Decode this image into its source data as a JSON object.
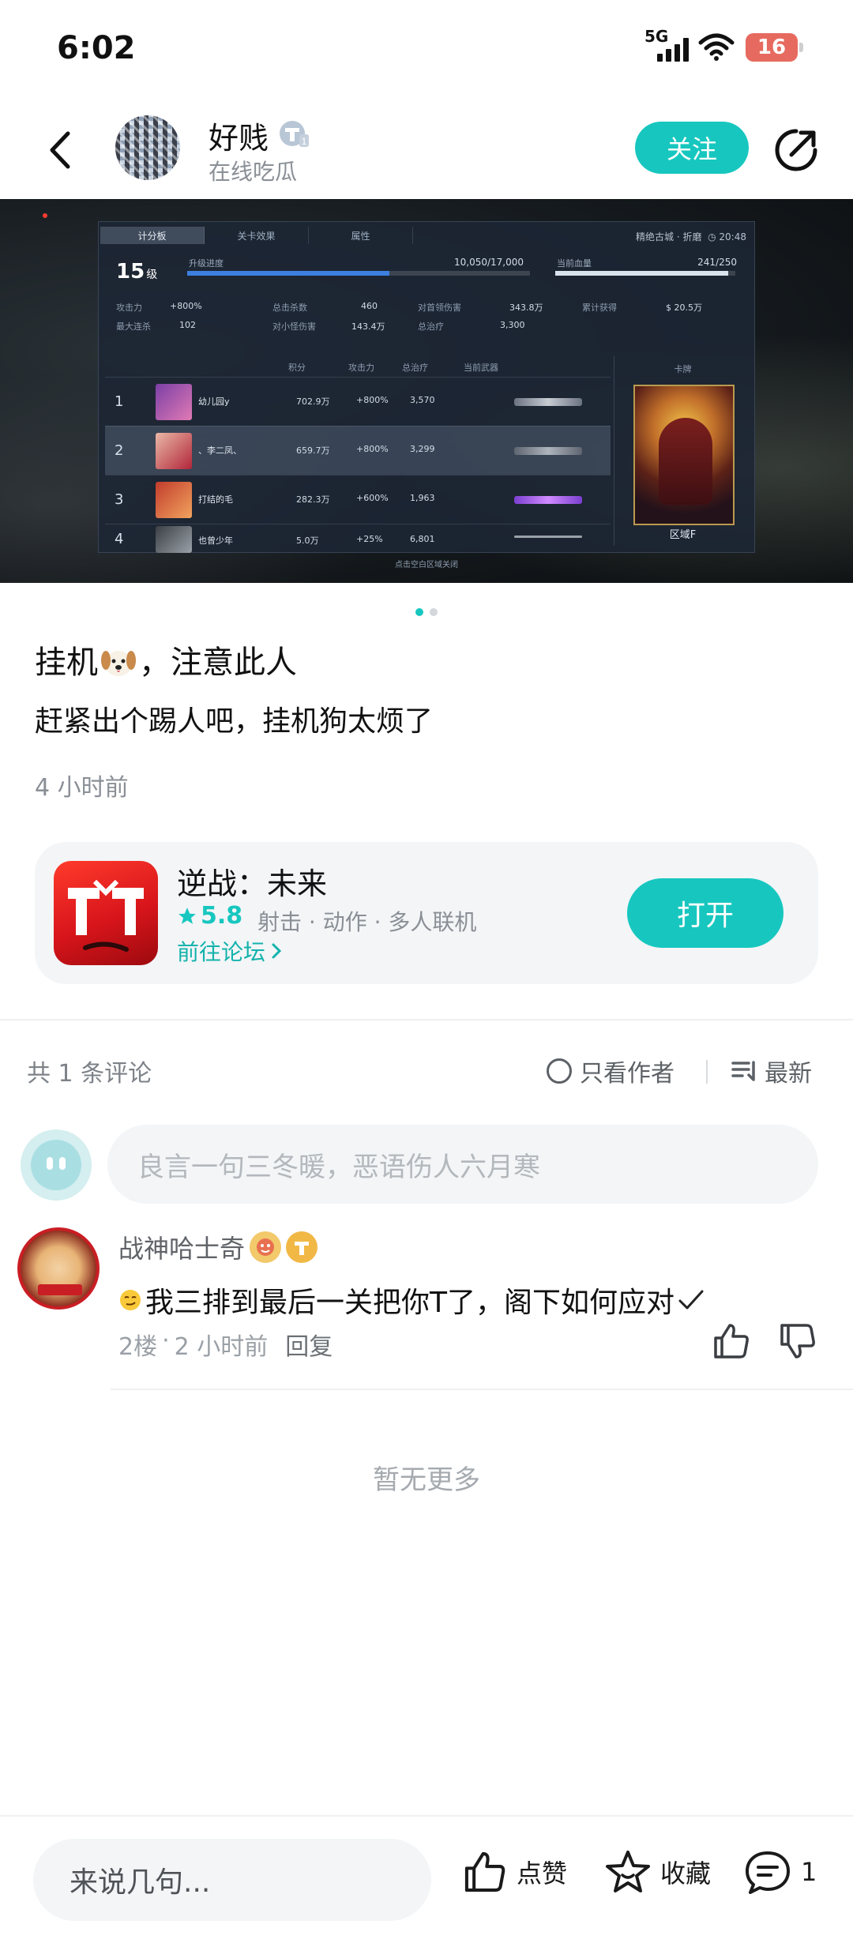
{
  "status_bar": {
    "time": "6:02",
    "network": "5G",
    "battery": "16",
    "icons": [
      "signal-icon",
      "wifi-icon",
      "battery-icon"
    ]
  },
  "header": {
    "username": "好贱",
    "subtitle": "在线吃瓜",
    "follow_label": "关注",
    "icons": [
      "back-icon",
      "verified-badge-icon",
      "share-icon"
    ]
  },
  "screenshot": {
    "tabs": [
      "计分板",
      "关卡效果",
      "属性"
    ],
    "location": "精绝古城 · 折磨",
    "timer": "20:48",
    "level": "15",
    "level_unit": "级",
    "progress_label": "升级进度",
    "progress_value": "10,050/17,000",
    "progress_fraction": 0.59,
    "hp_label": "当前血量",
    "hp_value": "241/250",
    "hp_fraction": 0.96,
    "stats": [
      {
        "k": "攻击力",
        "v": "+800%"
      },
      {
        "k": "总击杀数",
        "v": "460"
      },
      {
        "k": "对首领伤害",
        "v": "343.8万"
      },
      {
        "k": "累计获得",
        "v": "20.5万"
      },
      {
        "k": "最大连杀",
        "v": "102"
      },
      {
        "k": "对小怪伤害",
        "v": "143.4万"
      },
      {
        "k": "总治疗",
        "v": "3,300"
      }
    ],
    "table_headers": [
      "积分",
      "攻击力",
      "总治疗",
      "当前武器"
    ],
    "rows": [
      {
        "rank": "1",
        "name": "幼儿园y",
        "score": "702.9万",
        "atk": "+800%",
        "heal": "3,570"
      },
      {
        "rank": "2",
        "name": "、李二凤、",
        "score": "659.7万",
        "atk": "+800%",
        "heal": "3,299"
      },
      {
        "rank": "3",
        "name": "打结的毛",
        "score": "282.3万",
        "atk": "+600%",
        "heal": "1,963"
      },
      {
        "rank": "4",
        "name": "也曾少年",
        "score": "5.0万",
        "atk": "+25%",
        "heal": "6,801"
      }
    ],
    "card_label": "卡牌",
    "zone": "区域F",
    "footer": "点击空白区域关闭"
  },
  "post": {
    "title_prefix": "挂机",
    "title_suffix": "，注意此人",
    "body": "赶紧出个踢人吧，挂机狗太烦了",
    "time": "4 小时前",
    "carousel_index": 1,
    "carousel_total": 2
  },
  "game": {
    "name": "逆战：未来",
    "rating": "5.8",
    "tags": "射击 · 动作 · 多人联机",
    "forum_link": "前往论坛",
    "open_label": "打开"
  },
  "comments_header": {
    "count_text": "共 1 条评论",
    "only_author": "只看作者",
    "sort": "最新"
  },
  "comment_input": {
    "placeholder": "良言一句三冬暖，恶语伤人六月寒"
  },
  "comments": [
    {
      "user": "战神哈士奇",
      "text": "我三排到最后一关把你T了，阁下如何应对",
      "floor": "2楼",
      "time": "2 小时前",
      "reply_label": "回复"
    }
  ],
  "no_more": "暂无更多",
  "bottom_bar": {
    "input_placeholder": "来说几句...",
    "like_label": "点赞",
    "favorite_label": "收藏",
    "comment_count": "1"
  },
  "colors": {
    "accent": "#17c7bf",
    "text": "#111111",
    "muted": "#8a8f96",
    "card_bg": "#f3f5f7"
  }
}
